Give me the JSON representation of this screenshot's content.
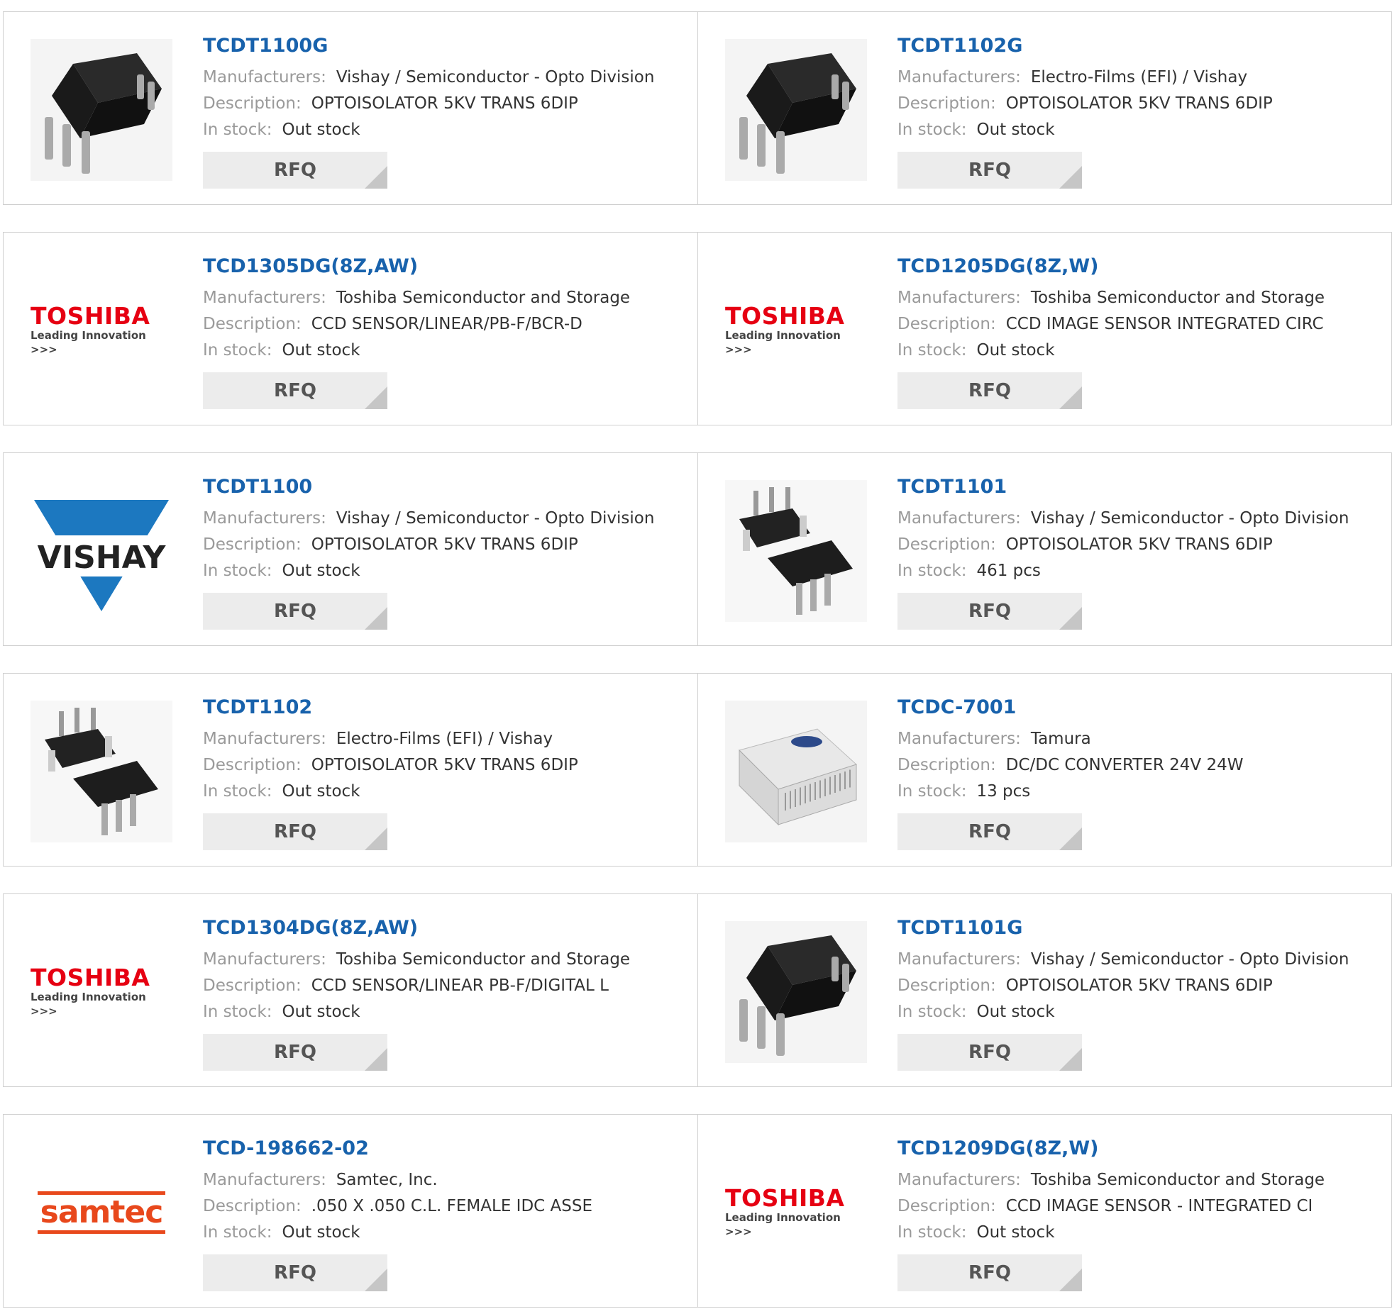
{
  "labels": {
    "manufacturers": "Manufacturers:",
    "description": "Description:",
    "in_stock": "In stock:",
    "rfq": "RFQ"
  },
  "products": [
    {
      "part": "TCDT1100G",
      "manufacturer": "Vishay / Semiconductor - Opto Division",
      "description": "OPTOISOLATOR 5KV TRANS 6DIP",
      "stock": "Out stock",
      "image": "dip6-chip-icon"
    },
    {
      "part": "TCDT1102G",
      "manufacturer": "Electro-Films (EFI) / Vishay",
      "description": "OPTOISOLATOR 5KV TRANS 6DIP",
      "stock": "Out stock",
      "image": "dip6-chip-icon"
    },
    {
      "part": "TCD1305DG(8Z,AW)",
      "manufacturer": "Toshiba Semiconductor and Storage",
      "description": "CCD SENSOR/LINEAR/PB-F/BCR-D",
      "stock": "Out stock",
      "image": "toshiba-logo",
      "logo_text": "TOSHIBA",
      "logo_tagline": "Leading Innovation >>>"
    },
    {
      "part": "TCD1205DG(8Z,W)",
      "manufacturer": "Toshiba Semiconductor and Storage",
      "description": "CCD IMAGE SENSOR INTEGRATED CIRC",
      "stock": "Out stock",
      "image": "toshiba-logo",
      "logo_text": "TOSHIBA",
      "logo_tagline": "Leading Innovation >>>"
    },
    {
      "part": "TCDT1100",
      "manufacturer": "Vishay / Semiconductor - Opto Division",
      "description": "OPTOISOLATOR 5KV TRANS 6DIP",
      "stock": "Out stock",
      "image": "vishay-logo",
      "logo_text": "VISHAY"
    },
    {
      "part": "TCDT1101",
      "manufacturer": "Vishay / Semiconductor - Opto Division",
      "description": "OPTOISOLATOR 5KV TRANS 6DIP",
      "stock": "461 pcs",
      "image": "dip6-pair-icon"
    },
    {
      "part": "TCDT1102",
      "manufacturer": "Electro-Films (EFI) / Vishay",
      "description": "OPTOISOLATOR 5KV TRANS 6DIP",
      "stock": "Out stock",
      "image": "dip6-pair-icon"
    },
    {
      "part": "TCDC-7001",
      "manufacturer": "Tamura",
      "description": "DC/DC CONVERTER 24V 24W",
      "stock": "13 pcs",
      "image": "din-rail-module-icon"
    },
    {
      "part": "TCD1304DG(8Z,AW)",
      "manufacturer": "Toshiba Semiconductor and Storage",
      "description": "CCD SENSOR/LINEAR PB-F/DIGITAL L",
      "stock": "Out stock",
      "image": "toshiba-logo",
      "logo_text": "TOSHIBA",
      "logo_tagline": "Leading Innovation >>>"
    },
    {
      "part": "TCDT1101G",
      "manufacturer": "Vishay / Semiconductor - Opto Division",
      "description": "OPTOISOLATOR 5KV TRANS 6DIP",
      "stock": "Out stock",
      "image": "dip6-chip-icon"
    },
    {
      "part": "TCD-198662-02",
      "manufacturer": "Samtec, Inc.",
      "description": ".050 X .050 C.L. FEMALE IDC ASSE",
      "stock": "Out stock",
      "image": "samtec-logo",
      "logo_text": "samtec"
    },
    {
      "part": "TCD1209DG(8Z,W)",
      "manufacturer": "Toshiba Semiconductor and Storage",
      "description": "CCD IMAGE SENSOR - INTEGRATED CI",
      "stock": "Out stock",
      "image": "toshiba-logo",
      "logo_text": "TOSHIBA",
      "logo_tagline": "Leading Innovation >>>"
    }
  ],
  "colors": {
    "part_link": "#1862ac",
    "label": "#9a9a9a",
    "value": "#333333",
    "rfq_bg": "#ececec",
    "border": "#cfcfcf",
    "toshiba_red": "#e60012",
    "vishay_blue": "#1c78c0",
    "samtec_orange": "#e8481c"
  }
}
